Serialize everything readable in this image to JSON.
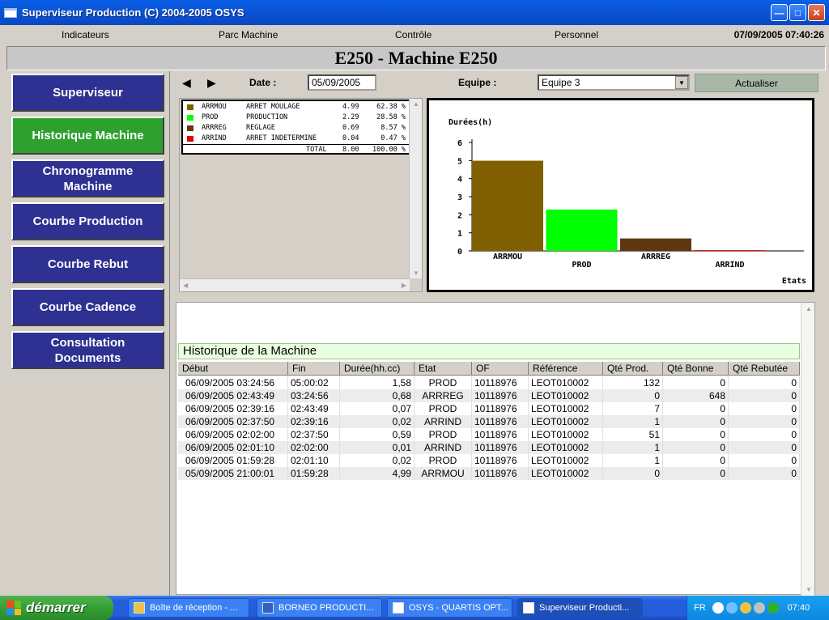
{
  "window": {
    "title": "Superviseur Production (C) 2004-2005 OSYS"
  },
  "menu": {
    "items": [
      "Indicateurs",
      "Parc Machine",
      "Contrôle",
      "Personnel"
    ],
    "datetime": "07/09/2005 07:40:26"
  },
  "header": {
    "title": "E250 - Machine E250"
  },
  "sidebar": {
    "items": [
      {
        "label": "Superviseur"
      },
      {
        "label": "Historique Machine"
      },
      {
        "label": "Chronogramme Machine"
      },
      {
        "label": "Courbe Production"
      },
      {
        "label": "Courbe Rebut"
      },
      {
        "label": "Courbe Cadence"
      },
      {
        "label": "Consultation Documents"
      }
    ]
  },
  "toolbar": {
    "date_label": "Date :",
    "date_value": "05/09/2005",
    "team_label": "Equipe :",
    "team_value": "Equipe 3",
    "refresh_label": "Actualiser"
  },
  "legend": {
    "rows": [
      {
        "code": "ARRMOU",
        "desc": "ARRET MOULAGE",
        "value": "4.99",
        "pct": "62.38 %",
        "color": "#806000"
      },
      {
        "code": "PROD",
        "desc": "PRODUCTION",
        "value": "2.29",
        "pct": "28.58 %",
        "color": "#00ff00"
      },
      {
        "code": "ARRREG",
        "desc": "REGLAGE",
        "value": "0.69",
        "pct": "8.57 %",
        "color": "#603810"
      },
      {
        "code": "ARRIND",
        "desc": "ARRET INDETERMINE",
        "value": "0.04",
        "pct": "0.47 %",
        "color": "#e00000"
      }
    ],
    "total_label": "TOTAL",
    "total_value": "8.00",
    "total_pct": "100.00 %"
  },
  "chart_data": {
    "type": "bar",
    "ylabel": "Durées(h)",
    "xlabel": "Etats",
    "categories": [
      "ARRMOU",
      "PROD",
      "ARRREG",
      "ARRIND"
    ],
    "values": [
      4.99,
      2.29,
      0.69,
      0.04
    ],
    "colors": [
      "#806000",
      "#00ff00",
      "#603810",
      "#e00000"
    ],
    "yticks": [
      0,
      1,
      2,
      3,
      4,
      5,
      6
    ],
    "ylim": [
      0,
      6
    ],
    "grid": false
  },
  "history": {
    "title": "Historique de la Machine",
    "columns": [
      "Début",
      "Fin",
      "Durée(hh.cc)",
      "Etat",
      "OF",
      "Référence",
      "Qté Prod.",
      "Qté Bonne",
      "Qté Rebutée"
    ],
    "rows": [
      [
        "06/09/2005 03:24:56",
        "05:00:02",
        "1,58",
        "PROD",
        "10118976",
        "LEOT010002",
        "132",
        "0",
        "0"
      ],
      [
        "06/09/2005 02:43:49",
        "03:24:56",
        "0,68",
        "ARRREG",
        "10118976",
        "LEOT010002",
        "0",
        "648",
        "0"
      ],
      [
        "06/09/2005 02:39:16",
        "02:43:49",
        "0,07",
        "PROD",
        "10118976",
        "LEOT010002",
        "7",
        "0",
        "0"
      ],
      [
        "06/09/2005 02:37:50",
        "02:39:16",
        "0,02",
        "ARRIND",
        "10118976",
        "LEOT010002",
        "1",
        "0",
        "0"
      ],
      [
        "06/09/2005 02:02:00",
        "02:37:50",
        "0,59",
        "PROD",
        "10118976",
        "LEOT010002",
        "51",
        "0",
        "0"
      ],
      [
        "06/09/2005 02:01:10",
        "02:02:00",
        "0,01",
        "ARRIND",
        "10118976",
        "LEOT010002",
        "1",
        "0",
        "0"
      ],
      [
        "06/09/2005 01:59:28",
        "02:01:10",
        "0,02",
        "PROD",
        "10118976",
        "LEOT010002",
        "1",
        "0",
        "0"
      ],
      [
        "05/09/2005 21:00:01",
        "01:59:28",
        "4,99",
        "ARRMOU",
        "10118976",
        "LEOT010002",
        "0",
        "0",
        "0"
      ]
    ]
  },
  "taskbar": {
    "start_label": "démarrer",
    "tasks": [
      {
        "label": "Boîte de réception - ...",
        "icon": "outlook-icon"
      },
      {
        "label": "BORNEO PRODUCTI...",
        "icon": "word-icon"
      },
      {
        "label": "OSYS - QUARTIS OPT...",
        "icon": "window-icon"
      },
      {
        "label": "Superviseur Producti...",
        "icon": "window-icon"
      }
    ],
    "language": "FR",
    "clock": "07:40"
  }
}
